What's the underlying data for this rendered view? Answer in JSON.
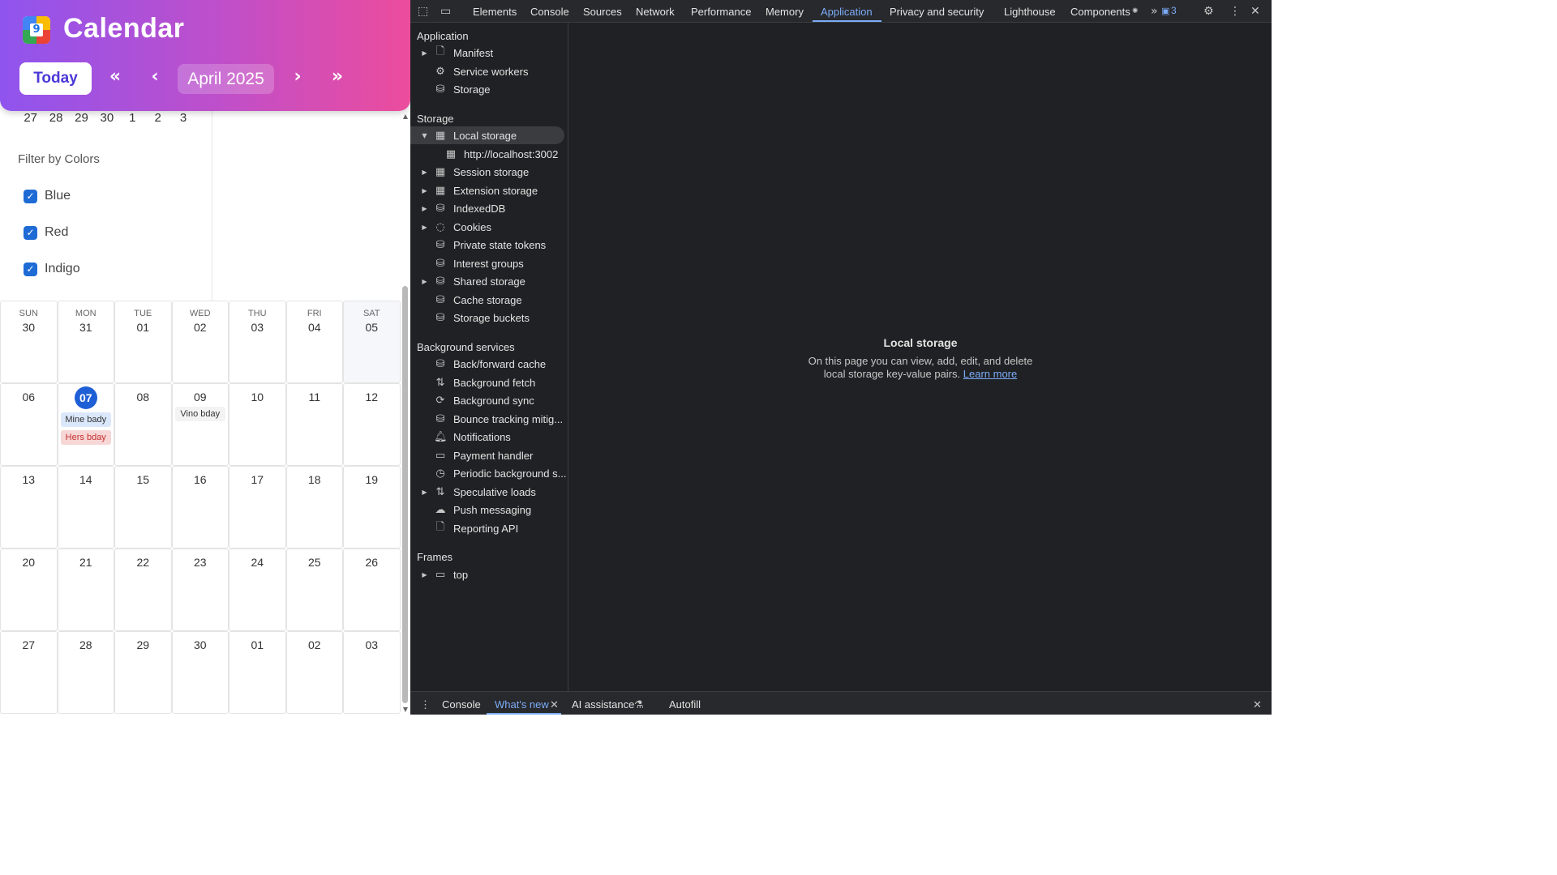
{
  "calendar": {
    "title": "Calendar",
    "logo_digit": "9",
    "today_label": "Today",
    "nav": {
      "prev_year": "«",
      "prev": "‹",
      "next": "›",
      "next_year": "»"
    },
    "month_label": "April 2025",
    "mini_week": [
      "27",
      "28",
      "29",
      "30",
      "1",
      "2",
      "3"
    ],
    "filter_title": "Filter by Colors",
    "filters": [
      {
        "label": "Blue",
        "checked": true
      },
      {
        "label": "Red",
        "checked": true
      },
      {
        "label": "Indigo",
        "checked": true
      }
    ],
    "weekdays": [
      "SUN",
      "MON",
      "TUE",
      "WED",
      "THU",
      "FRI",
      "SAT"
    ],
    "weeks": [
      [
        "30",
        "31",
        "01",
        "02",
        "03",
        "04",
        "05"
      ],
      [
        "06",
        "07",
        "08",
        "09",
        "10",
        "11",
        "12"
      ],
      [
        "13",
        "14",
        "15",
        "16",
        "17",
        "18",
        "19"
      ],
      [
        "20",
        "21",
        "22",
        "23",
        "24",
        "25",
        "26"
      ],
      [
        "27",
        "28",
        "29",
        "30",
        "01",
        "02",
        "03"
      ]
    ],
    "today": "07",
    "events": {
      "mon_07": [
        "Mine bady",
        "Hers bday"
      ],
      "wed_09": [
        "Vino bday"
      ]
    }
  },
  "devtools": {
    "tabs": [
      "Elements",
      "Console",
      "Sources",
      "Network",
      "Performance",
      "Memory",
      "Application",
      "Privacy and security",
      "Lighthouse",
      "Components"
    ],
    "active_tab": "Application",
    "issues_count": "3",
    "sidebar": {
      "application_head": "Application",
      "application": [
        "Manifest",
        "Service workers",
        "Storage"
      ],
      "storage_head": "Storage",
      "storage": [
        "Local storage",
        "http://localhost:3002",
        "Session storage",
        "Extension storage",
        "IndexedDB",
        "Cookies",
        "Private state tokens",
        "Interest groups",
        "Shared storage",
        "Cache storage",
        "Storage buckets"
      ],
      "background_head": "Background services",
      "background": [
        "Back/forward cache",
        "Background fetch",
        "Background sync",
        "Bounce tracking mitig...",
        "Notifications",
        "Payment handler",
        "Periodic background s...",
        "Speculative loads",
        "Push messaging",
        "Reporting API"
      ],
      "frames_head": "Frames",
      "frames": [
        "top"
      ]
    },
    "main": {
      "title": "Local storage",
      "line1": "On this page you can view, add, edit, and delete",
      "line2": "local storage key-value pairs.",
      "learn_more": "Learn more"
    },
    "drawer": {
      "tabs": [
        "Console",
        "What's new",
        "AI assistance",
        "Autofill"
      ],
      "active": "What's new"
    }
  },
  "colors": {
    "header_gradient_start": "#8f54ee",
    "header_gradient_end": "#ec4c9c",
    "checkbox": "#1f6bd6",
    "today_dot": "#1f5fd6",
    "devtools_bg": "#202124",
    "devtools_accent": "#7cacf8"
  }
}
